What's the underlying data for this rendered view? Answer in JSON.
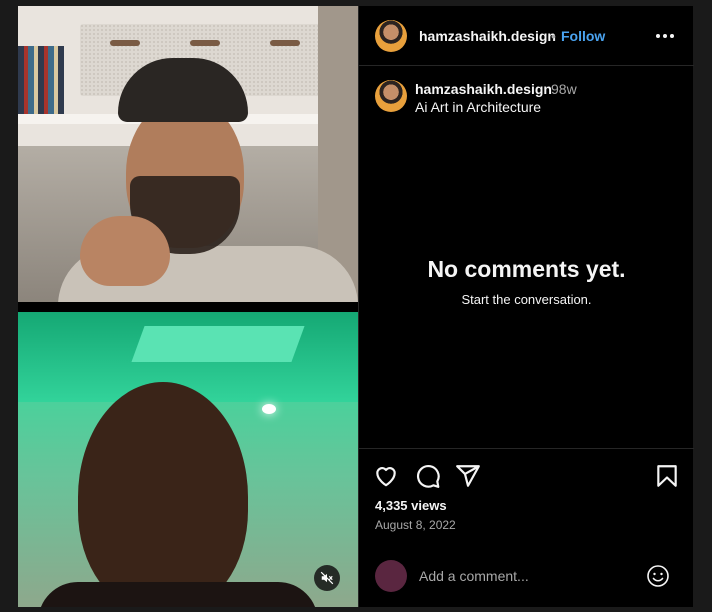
{
  "post": {
    "username": "hamzashaikh.design",
    "follow_label": "Follow",
    "separator": "•",
    "age": "98w",
    "caption": "Ai Art in Architecture"
  },
  "comments": {
    "empty_title": "No comments yet.",
    "empty_subtitle": "Start the conversation."
  },
  "stats": {
    "views": "4,335 views",
    "date": "August 8, 2022"
  },
  "composer": {
    "placeholder": "Add a comment..."
  },
  "icons": [
    "more-options-icon",
    "heart-icon",
    "comment-icon",
    "share-icon",
    "bookmark-icon",
    "emoji-icon",
    "muted-speaker-icon"
  ],
  "colors": {
    "accent": "#4aa3f0",
    "background": "#000000",
    "secondary_text": "#a8a8a8"
  }
}
